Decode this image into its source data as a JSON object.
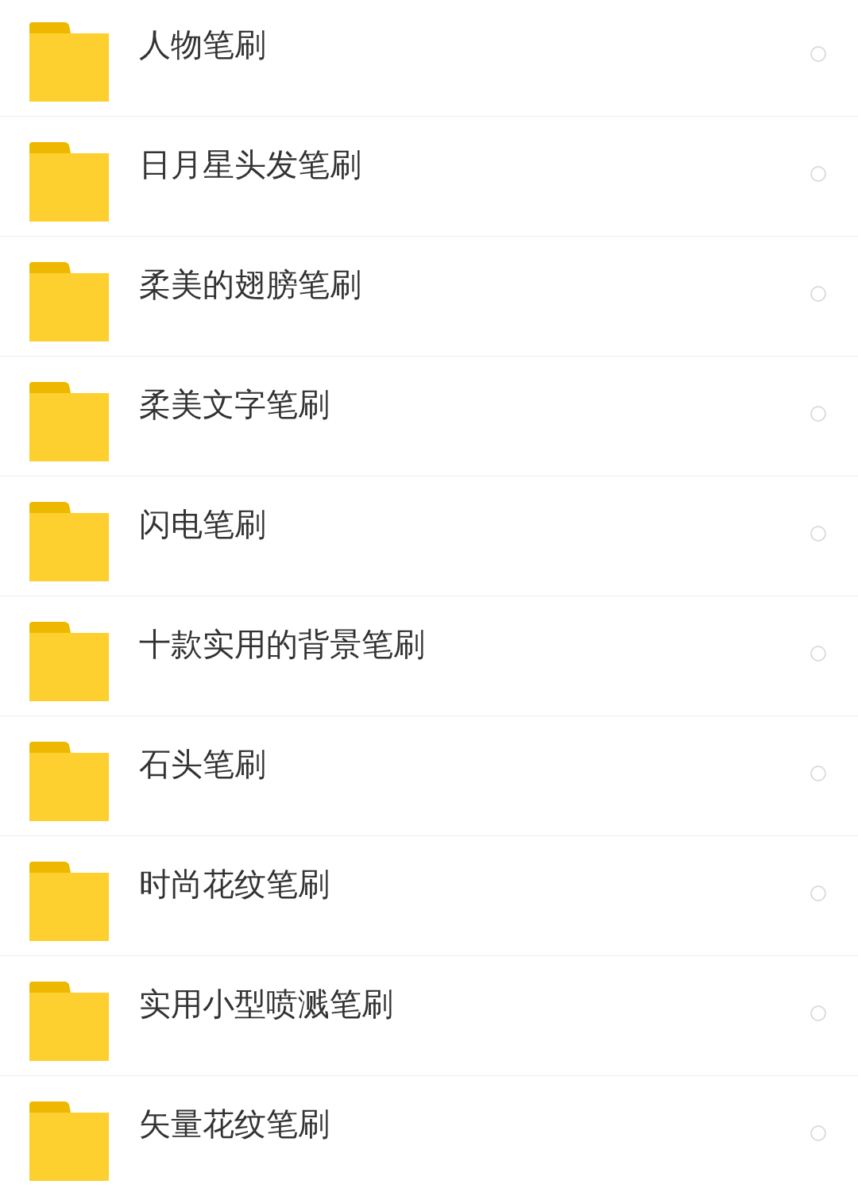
{
  "folders": [
    {
      "name": "人物笔刷",
      "selected": false
    },
    {
      "name": "日月星头发笔刷",
      "selected": false
    },
    {
      "name": "柔美的翅膀笔刷",
      "selected": false
    },
    {
      "name": "柔美文字笔刷",
      "selected": false
    },
    {
      "name": "闪电笔刷",
      "selected": false
    },
    {
      "name": "十款实用的背景笔刷",
      "selected": false
    },
    {
      "name": "石头笔刷",
      "selected": false
    },
    {
      "name": "时尚花纹笔刷",
      "selected": false
    },
    {
      "name": "实用小型喷溅笔刷",
      "selected": false
    },
    {
      "name": "矢量花纹笔刷",
      "selected": false
    }
  ]
}
